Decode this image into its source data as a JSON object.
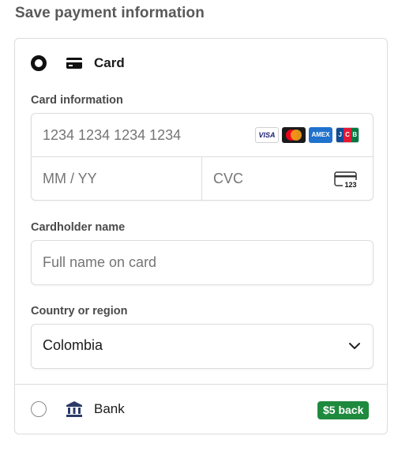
{
  "heading": "Save payment information",
  "methods": {
    "card": {
      "label": "Card",
      "selected": true,
      "icon": "credit-card-icon"
    },
    "bank": {
      "label": "Bank",
      "selected": false,
      "icon": "bank-icon",
      "badge": "$5 back"
    }
  },
  "card_information": {
    "label": "Card information",
    "number_placeholder": "1234 1234 1234 1234",
    "expiry_placeholder": "MM / YY",
    "cvc_placeholder": "CVC",
    "cvc_icon_text": "123",
    "brands": [
      {
        "name": "visa",
        "text": "VISA"
      },
      {
        "name": "mastercard",
        "text": ""
      },
      {
        "name": "amex",
        "text": "AMEX"
      },
      {
        "name": "jcb",
        "text": "JCB"
      }
    ]
  },
  "cardholder": {
    "label": "Cardholder name",
    "placeholder": "Full name on card"
  },
  "country": {
    "label": "Country or region",
    "value": "Colombia"
  },
  "colors": {
    "badge": "#1e8a3e",
    "border": "#dcdcdc",
    "heading": "#595959"
  }
}
